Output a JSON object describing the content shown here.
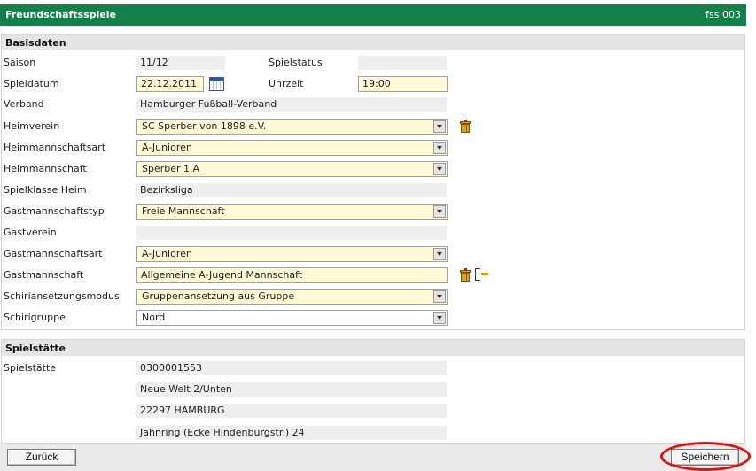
{
  "window": {
    "title": "Freundschaftsspiele",
    "code": "fss 003"
  },
  "basis": {
    "heading": "Basisdaten",
    "saison": {
      "label": "Saison",
      "value": "11/12"
    },
    "spielstatus": {
      "label": "Spielstatus",
      "value": ""
    },
    "spieldatum": {
      "label": "Spieldatum",
      "value": "22.12.2011"
    },
    "uhrzeit": {
      "label": "Uhrzeit",
      "value": "19:00"
    },
    "verband": {
      "label": "Verband",
      "value": "Hamburger Fußball-Verband"
    },
    "heimverein": {
      "label": "Heimverein",
      "value": "SC Sperber von 1898 e.V."
    },
    "heimmannschaftsart": {
      "label": "Heimmannschaftsart",
      "value": "A-Junioren"
    },
    "heimmannschaft": {
      "label": "Heimmannschaft",
      "value": "Sperber 1.A"
    },
    "spielklasse": {
      "label": "Spielklasse Heim",
      "value": "Bezirksliga"
    },
    "gastmannschaftstyp": {
      "label": "Gastmannschaftstyp",
      "value": "Freie Mannschaft"
    },
    "gastverein": {
      "label": "Gastverein",
      "value": ""
    },
    "gastmannschaftsart": {
      "label": "Gastmannschaftsart",
      "value": "A-Junioren"
    },
    "gastmannschaft": {
      "label": "Gastmannschaft",
      "value": "Allgemeine A-Jugend Mannschaft"
    },
    "schiriansetzung": {
      "label": "Schiriansetzungsmodus",
      "value": "Gruppenansetzung aus Gruppe"
    },
    "schirigruppe": {
      "label": "Schirigruppe",
      "value": "Nord"
    }
  },
  "spielstaette": {
    "heading": "Spielstätte",
    "label": "Spielstätte",
    "lines": [
      "0300001553",
      "Neue Welt 2/Unten",
      "22297 HAMBURG",
      "Jahnring (Ecke Hindenburgstr.) 24"
    ]
  },
  "buttons": {
    "back": "Zurück",
    "save": "Speichern"
  },
  "colors": {
    "titlebar": "#13804a",
    "required_field": "#fffbd6",
    "highlight_circle": "#e01010"
  }
}
